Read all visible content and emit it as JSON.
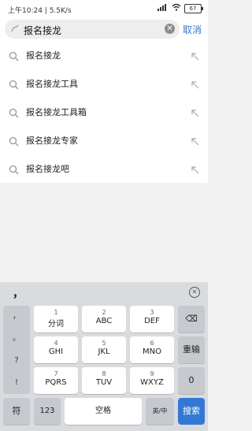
{
  "status": {
    "time": "上午10:24 | 5.5K/s",
    "battery": "67"
  },
  "search": {
    "value": "报名接龙",
    "cancel_label": "取消"
  },
  "suggestions": [
    {
      "label": "报名接龙"
    },
    {
      "label": "报名接龙工具"
    },
    {
      "label": "报名接龙工具箱"
    },
    {
      "label": "报名接龙专家"
    },
    {
      "label": "报名接龙吧"
    }
  ],
  "keyboard": {
    "top_punct": "，",
    "punctuation": [
      "，",
      "。",
      "?",
      "!"
    ],
    "rows": [
      [
        {
          "num": "1",
          "letters": "分词"
        },
        {
          "num": "2",
          "letters": "ABC"
        },
        {
          "num": "3",
          "letters": "DEF"
        }
      ],
      [
        {
          "num": "4",
          "letters": "GHI"
        },
        {
          "num": "5",
          "letters": "JKL"
        },
        {
          "num": "6",
          "letters": "MNO"
        }
      ],
      [
        {
          "num": "7",
          "letters": "PQRS"
        },
        {
          "num": "8",
          "letters": "TUV"
        },
        {
          "num": "9",
          "letters": "WXYZ"
        }
      ]
    ],
    "delete_label": "⌫",
    "reenter_label": "重输",
    "zero_label": "0",
    "symbol_label": "符",
    "num_label": "123",
    "space_label": "空格",
    "lang_label": "英/中",
    "search_label": "搜索"
  }
}
